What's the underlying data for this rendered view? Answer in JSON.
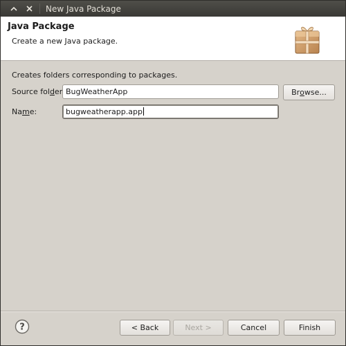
{
  "window": {
    "title": "New Java Package",
    "controls": [
      "chevron-up-icon",
      "close-icon"
    ]
  },
  "banner": {
    "title": "Java Package",
    "description": "Create a new Java package.",
    "icon": "package-icon"
  },
  "form": {
    "intro": "Creates folders corresponding to packages.",
    "source_folder": {
      "label_pre": "Source fol",
      "label_mnemonic": "d",
      "label_post": "er:",
      "value": "BugWeatherApp",
      "browse_pre": "Br",
      "browse_mnemonic": "o",
      "browse_post": "wse..."
    },
    "name": {
      "label_pre": "Na",
      "label_mnemonic": "m",
      "label_post": "e:",
      "value": "bugweatherapp.app"
    }
  },
  "buttons": {
    "back": "< Back",
    "next": "Next >",
    "cancel": "Cancel",
    "finish": "Finish"
  },
  "help": {
    "icon": "help-icon"
  },
  "colors": {
    "dialog_bg": "#d6d2cb",
    "titlebar_bg": "#3c3b37",
    "banner_bg": "#ffffff"
  }
}
